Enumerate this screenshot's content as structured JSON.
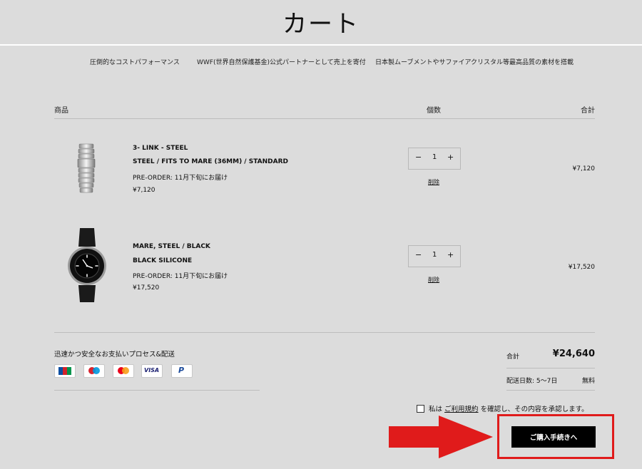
{
  "page": {
    "title": "カート"
  },
  "features": [
    "圧倒的なコストパフォーマンス",
    "WWF(世界自然保護基金)公式パートナーとして売上を寄付",
    "日本製ムーブメントやサファイアクリスタル等最高品質の素材を搭載"
  ],
  "table": {
    "product_header": "商品",
    "qty_header": "個数",
    "total_header": "合計"
  },
  "items": [
    {
      "name": "3- LINK - STEEL",
      "variant": "STEEL / FITS TO MARE (36MM) / STANDARD",
      "preorder": "PRE-ORDER: 11月下旬にお届け",
      "price": "¥7,120",
      "qty": "1",
      "minus": "−",
      "plus": "+",
      "remove": "削除",
      "line_total": "¥7,120"
    },
    {
      "name": "MARE, STEEL / BLACK",
      "variant": "BLACK SILICONE",
      "preorder": "PRE-ORDER: 11月下旬にお届け",
      "price": "¥17,520",
      "qty": "1",
      "minus": "−",
      "plus": "+",
      "remove": "削除",
      "line_total": "¥17,520"
    }
  ],
  "payment": {
    "heading": "迅速かつ安全なお支払いプロセス&配送",
    "methods": [
      "JCB",
      "Maestro",
      "Mastercard",
      "VISA",
      "PayPal"
    ]
  },
  "summary": {
    "total_label": "合計",
    "total_value": "¥24,640",
    "shipping_label": "配送日数: 5〜7日",
    "shipping_value": "無料"
  },
  "terms": {
    "prefix": "私は",
    "link": "ご利用規約",
    "suffix": "を確認し、その内容を承認します。"
  },
  "checkout": {
    "label": "ご購入手続きへ"
  },
  "colors": {
    "background": "#dcdcdc",
    "button": "#000000",
    "annotation": "#e01b1b"
  }
}
